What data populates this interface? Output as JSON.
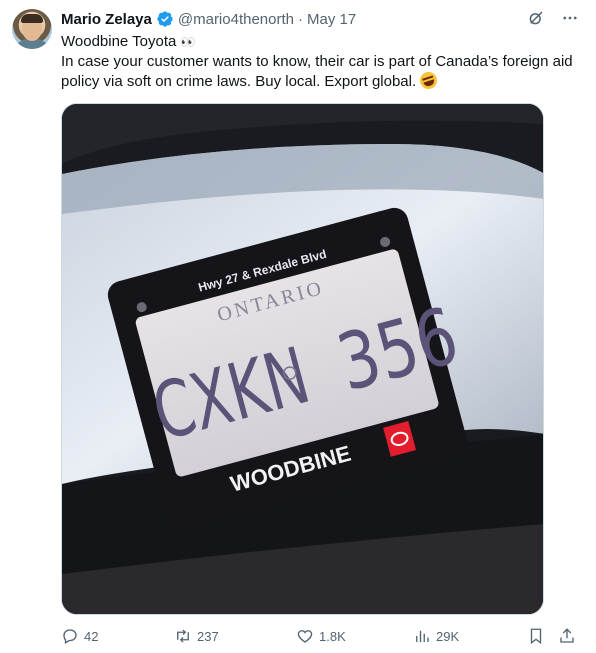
{
  "author": {
    "name": "Mario Zelaya",
    "handle": "@mario4thenorth",
    "separator": "·",
    "date": "May 17",
    "verified_color": "#1d9bf0"
  },
  "tweet": {
    "line1": "Woodbine Toyota",
    "line1_emoji": "👀",
    "line2": "In case your customer wants to know, their car is part of Canada’s foreign aid policy via soft on crime laws. Buy local. Export global.",
    "line2_emoji": "🤣"
  },
  "media": {
    "plate_text_left": "CXKN",
    "plate_text_right": "356",
    "plate_province": "ONTARIO",
    "frame_top_text": "Hwy 27 & Rexdale Blvd",
    "frame_bottom_text": "WOODBINE"
  },
  "engagement": {
    "replies": "42",
    "retweets": "237",
    "likes": "1.8K",
    "views": "29K"
  },
  "icons": {
    "verified": "verified-badge-icon",
    "grok": "grok-icon",
    "more": "more-icon",
    "reply": "reply-icon",
    "retweet": "retweet-icon",
    "like": "heart-icon",
    "views": "views-chart-icon",
    "bookmark": "bookmark-icon",
    "share": "share-icon"
  },
  "colors": {
    "text": "#0f1419",
    "secondary": "#536471",
    "accent": "#1d9bf0"
  }
}
